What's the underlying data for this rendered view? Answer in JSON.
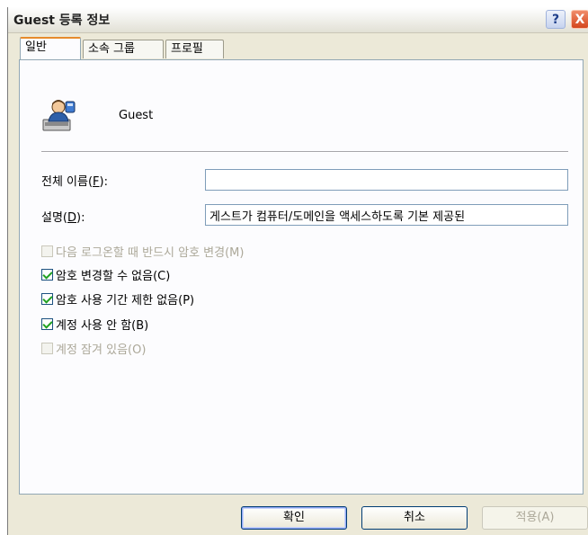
{
  "window": {
    "title": "Guest 등록 정보",
    "help_glyph": "?",
    "close_glyph": "X"
  },
  "tabs": [
    {
      "label": "일반",
      "active": true
    },
    {
      "label": "소속 그룹",
      "active": false
    },
    {
      "label": "프로필",
      "active": false
    }
  ],
  "general": {
    "icon": "user-account-icon",
    "user_name": "Guest",
    "full_name_label": "전체 이름(F):",
    "full_name_value": "",
    "description_label": "설명(D):",
    "description_value": "게스트가 컴퓨터/도메인을 액세스하도록 기본 제공된",
    "checkboxes": [
      {
        "label": "다음 로그온할 때 반드시 암호 변경(M)",
        "checked": false,
        "enabled": false
      },
      {
        "label": "암호 변경할 수 없음(C)",
        "checked": true,
        "enabled": true
      },
      {
        "label": "암호 사용 기간 제한 없음(P)",
        "checked": true,
        "enabled": true
      },
      {
        "label": "계정 사용 안 함(B)",
        "checked": true,
        "enabled": true
      },
      {
        "label": "계정 잠겨 있음(O)",
        "checked": false,
        "enabled": false
      }
    ]
  },
  "buttons": {
    "ok": "확인",
    "cancel": "취소",
    "apply": "적용(A)"
  },
  "colors": {
    "dialog_bg": "#ece9d8",
    "panel_bg": "#fcfcfe",
    "active_tab_accent": "#e68b2c",
    "check_green": "#21a121",
    "disabled_text": "#aca899"
  }
}
